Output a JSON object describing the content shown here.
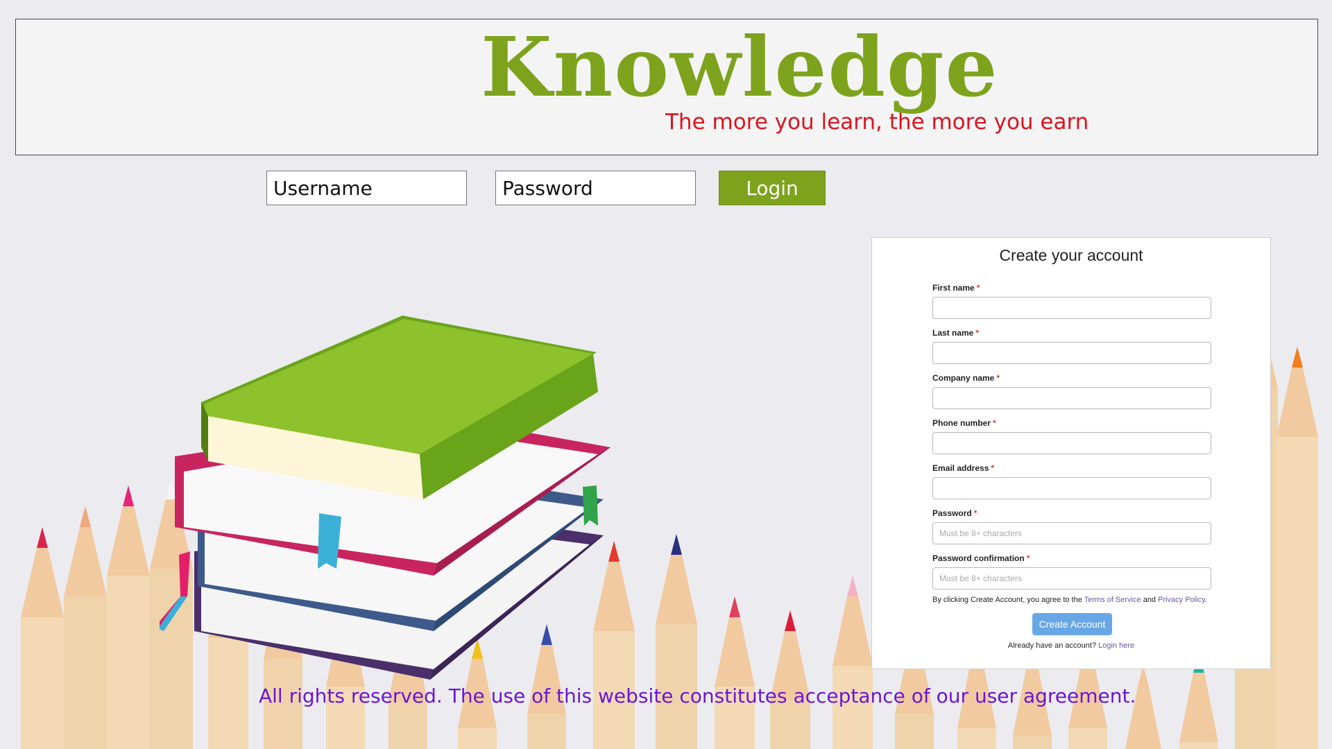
{
  "header": {
    "logo": "Knowledge",
    "tagline": "The more you learn, the more you earn"
  },
  "login": {
    "username_placeholder": "Username",
    "password_placeholder": "Password",
    "login_label": "Login"
  },
  "signup": {
    "title": "Create your account",
    "required_mark": "*",
    "fields": [
      {
        "label": "First name",
        "placeholder": ""
      },
      {
        "label": "Last name",
        "placeholder": ""
      },
      {
        "label": "Company name",
        "placeholder": ""
      },
      {
        "label": "Phone number",
        "placeholder": ""
      },
      {
        "label": "Email address",
        "placeholder": ""
      },
      {
        "label": "Password",
        "placeholder": "Must be 8+ characters"
      },
      {
        "label": "Password confirmation",
        "placeholder": "Must be 8+ characters"
      }
    ],
    "terms_prefix": "By clicking Create Account, you agree to the",
    "terms_link": "Terms of Service",
    "terms_and": "and",
    "privacy_link": "Privacy Policy",
    "terms_suffix": ".",
    "create_label": "Create Account",
    "already_text": "Already have an account?",
    "login_link": "Login here"
  },
  "footer": {
    "text": "All rights reserved. The use of this website constitutes acceptance of our user agreement."
  },
  "colors": {
    "brand_green": "#7da31d",
    "tagline_red": "#dc141e",
    "footer_purple": "#6a16d6",
    "button_blue": "#68a7e5"
  }
}
